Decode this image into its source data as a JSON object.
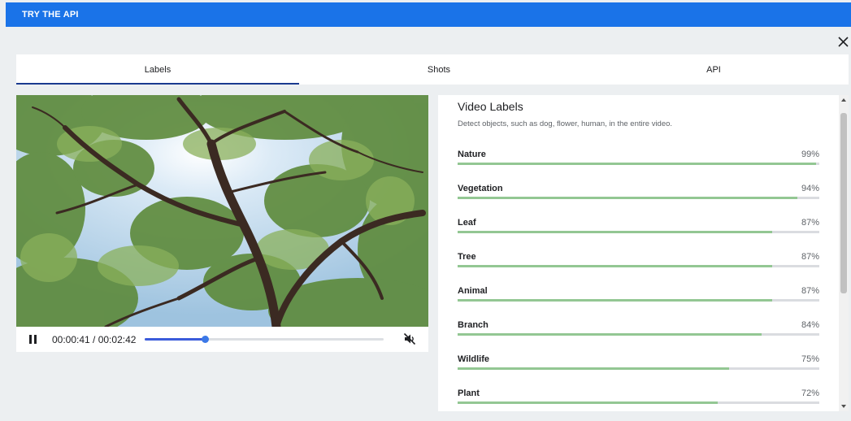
{
  "header": {
    "title": "TRY THE API"
  },
  "close": {
    "icon": "close-icon"
  },
  "tabs": [
    {
      "label": "Labels",
      "active": true
    },
    {
      "label": "Shots",
      "active": false
    },
    {
      "label": "API",
      "active": false
    }
  ],
  "player": {
    "time": "00:00:41 / 00:02:42",
    "progress": 0.253,
    "play_icon": "pause-icon",
    "mute_icon": "volume-muted-icon",
    "thumbnail_icon": "tree-canopy-image"
  },
  "labels_panel": {
    "title": "Video Labels",
    "subtitle": "Detect objects, such as dog, flower, human, in the entire video.",
    "items": [
      {
        "name": "Nature",
        "percent": "99%",
        "value": 0.99
      },
      {
        "name": "Vegetation",
        "percent": "94%",
        "value": 0.94
      },
      {
        "name": "Leaf",
        "percent": "87%",
        "value": 0.87
      },
      {
        "name": "Tree",
        "percent": "87%",
        "value": 0.87
      },
      {
        "name": "Animal",
        "percent": "87%",
        "value": 0.87
      },
      {
        "name": "Branch",
        "percent": "84%",
        "value": 0.84
      },
      {
        "name": "Wildlife",
        "percent": "75%",
        "value": 0.75
      },
      {
        "name": "Plant",
        "percent": "72%",
        "value": 0.72
      }
    ]
  },
  "colors": {
    "header_bg": "#1a73e8",
    "tab_underline": "#1a3a8f",
    "bar_fill": "#93c793",
    "seek_fill": "#3b5bdb"
  }
}
